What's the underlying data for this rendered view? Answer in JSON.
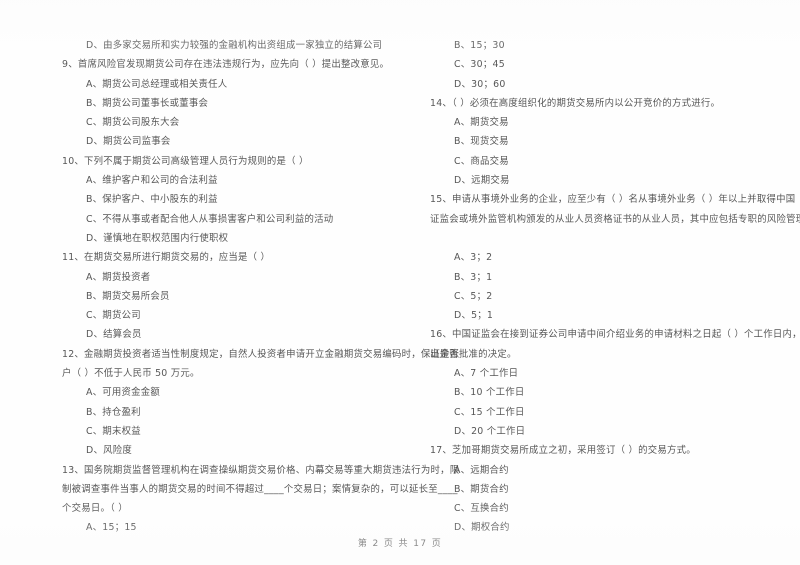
{
  "document": {
    "type": "scanned-exam-paper",
    "footer": "第 2 页 共 17 页"
  },
  "left_column": {
    "orphan_option": "D、由多家交易所和实力较强的金融机构出资组成一家独立的结算公司",
    "questions": [
      {
        "number": "9",
        "stem": "9、首席风险官发现期货公司存在违法违规行为，应先向（    ）提出整改意见。",
        "options": [
          "A、期货公司总经理或相关责任人",
          "B、期货公司董事长或董事会",
          "C、期货公司股东大会",
          "D、期货公司监事会"
        ]
      },
      {
        "number": "10",
        "stem": "10、下列不属于期货公司高级管理人员行为规则的是（    ）",
        "options": [
          "A、维护客户和公司的合法利益",
          "B、保护客户、中小股东的利益",
          "C、不得从事或者配合他人从事损害客户和公司利益的活动",
          "D、谨慎地在职权范围内行使职权"
        ]
      },
      {
        "number": "11",
        "stem": "11、在期货交易所进行期货交易的，应当是（    ）",
        "options": [
          "A、期货投资者",
          "B、期货交易所会员",
          "C、期货公司",
          "D、结算会员"
        ]
      },
      {
        "number": "12",
        "stem": "12、金融期货投资者适当性制度规定，自然人投资者申请开立金融期货交易编码时，保证金账",
        "stem_cont": "户（    ）不低于人民币 50 万元。",
        "options": [
          "A、可用资金金额",
          "B、持仓盈利",
          "C、期末权益",
          "D、风险度"
        ]
      },
      {
        "number": "13",
        "stem": "13、国务院期货监督管理机构在调查操纵期货交易价格、内幕交易等重大期货违法行为时，限",
        "stem_cont": "制被调查事件当事人的期货交易的时间不得超过____个交易日；案情复杂的，可以延长至____",
        "stem_cont2": "个交易日。（    ）",
        "options": [
          "A、15；15"
        ]
      }
    ]
  },
  "right_column": {
    "orphan_options": [
      "B、15；30",
      "C、30；45",
      "D、30；60"
    ],
    "questions": [
      {
        "number": "14",
        "stem": "14、（    ）必须在高度组织化的期货交易所内以公开竞价的方式进行。",
        "options": [
          "A、期货交易",
          "B、现货交易",
          "C、商品交易",
          "D、远期交易"
        ]
      },
      {
        "number": "15",
        "stem": "15、申请从事境外业务的企业，应至少有（    ）名从事境外业务（    ）年以上并取得中国",
        "stem_cont": "证监会或境外监管机构颁发的从业人员资格证书的从业人员，其中应包括专职的风险管理人员。",
        "options": [
          "A、3；2",
          "B、3；1",
          "C、5；2",
          "D、5；1"
        ]
      },
      {
        "number": "16",
        "stem": "16、中国证监会在接到证券公司申请中间介绍业务的申请材料之日起（    ）个工作日内，做",
        "stem_cont": "出是否批准的决定。",
        "options": [
          "A、7 个工作日",
          "B、10 个工作日",
          "C、15 个工作日",
          "D、20 个工作日"
        ]
      },
      {
        "number": "17",
        "stem": "17、芝加哥期货交易所成立之初，采用签订（    ）的交易方式。",
        "options": [
          "A、远期合约",
          "B、期货合约",
          "C、互换合约",
          "D、期权合约"
        ]
      }
    ]
  }
}
